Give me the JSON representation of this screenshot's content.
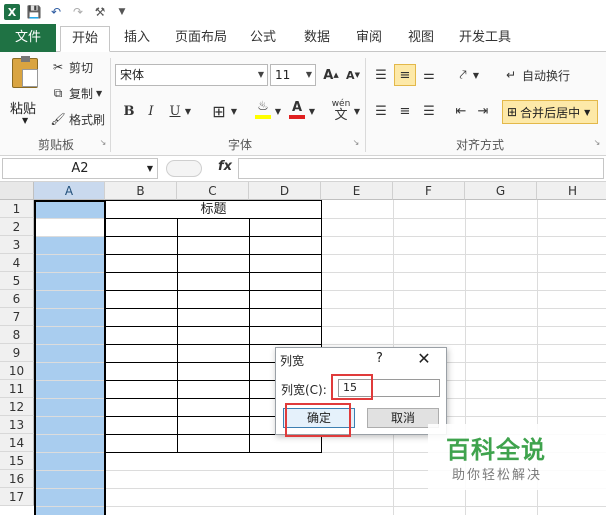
{
  "tabs": [
    "文件",
    "开始",
    "插入",
    "页面布局",
    "公式",
    "数据",
    "审阅",
    "视图",
    "开发工具"
  ],
  "clipboard": {
    "paste": "粘贴",
    "cut": "剪切",
    "copy": "复制",
    "format_painter": "格式刷",
    "group": "剪贴板"
  },
  "font": {
    "name": "宋体",
    "size": "11",
    "bold": "B",
    "italic": "I",
    "underline": "U",
    "group": "字体",
    "wen": "wén",
    "wen_char": "文"
  },
  "alignment": {
    "wrap": "自动换行",
    "merge": "合并后居中",
    "group": "对齐方式"
  },
  "formula_bar": {
    "name_box": "A2",
    "fx": "fx"
  },
  "grid": {
    "columns": [
      "A",
      "B",
      "C",
      "D",
      "E",
      "F",
      "G",
      "H"
    ],
    "rows": [
      "1",
      "2",
      "3",
      "4",
      "5",
      "6",
      "7",
      "8",
      "9",
      "10",
      "11",
      "12",
      "13",
      "14",
      "15",
      "16",
      "17"
    ],
    "title_cell": "标题"
  },
  "dialog": {
    "title": "列宽",
    "help": "?",
    "close": "✕",
    "label": "列宽(C):",
    "value": "15",
    "ok": "确定",
    "cancel": "取消"
  },
  "watermark": {
    "main": "百科全说",
    "sub": "助你轻松解决"
  },
  "colors": {
    "file_tab": "#1f7244",
    "selection": "#a9cdef",
    "highlight": "#e03b3b",
    "watermark": "#3fa34d"
  }
}
